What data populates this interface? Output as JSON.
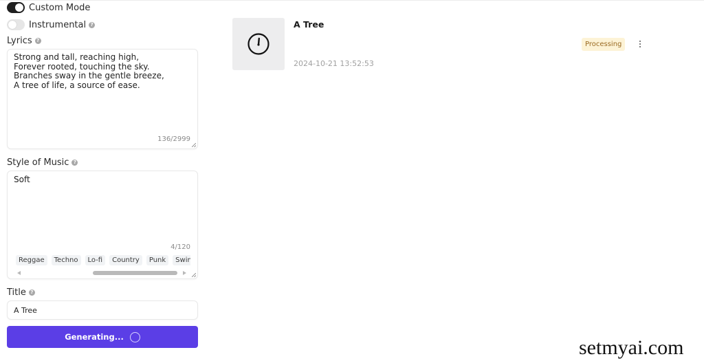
{
  "form": {
    "custom_mode": {
      "label": "Custom Mode",
      "enabled": true
    },
    "instrumental": {
      "label": "Instrumental",
      "enabled": false
    },
    "lyrics": {
      "label": "Lyrics",
      "value": "Strong and tall, reaching high,\nForever rooted, touching the sky.\nBranches sway in the gentle breeze,\nA tree of life, a source of ease.",
      "counter": "136/2999"
    },
    "style": {
      "label": "Style of Music",
      "value": "Soft",
      "counter": "4/120",
      "tags": [
        "Reggae",
        "Techno",
        "Lo-fi",
        "Country",
        "Punk",
        "Swing"
      ]
    },
    "title": {
      "label": "Title",
      "value": "A Tree"
    },
    "generate_button": {
      "label": "Generating..."
    },
    "help_glyph": "?"
  },
  "songs": [
    {
      "title": "A Tree",
      "date": "2024-10-21 13:52:53",
      "status": "Processing",
      "icon": "clock-icon"
    }
  ],
  "colors": {
    "accent": "#5b3ee6",
    "status_bg": "#fdf3d6",
    "status_text": "#9a6a22"
  },
  "watermark": "setmyai.com"
}
